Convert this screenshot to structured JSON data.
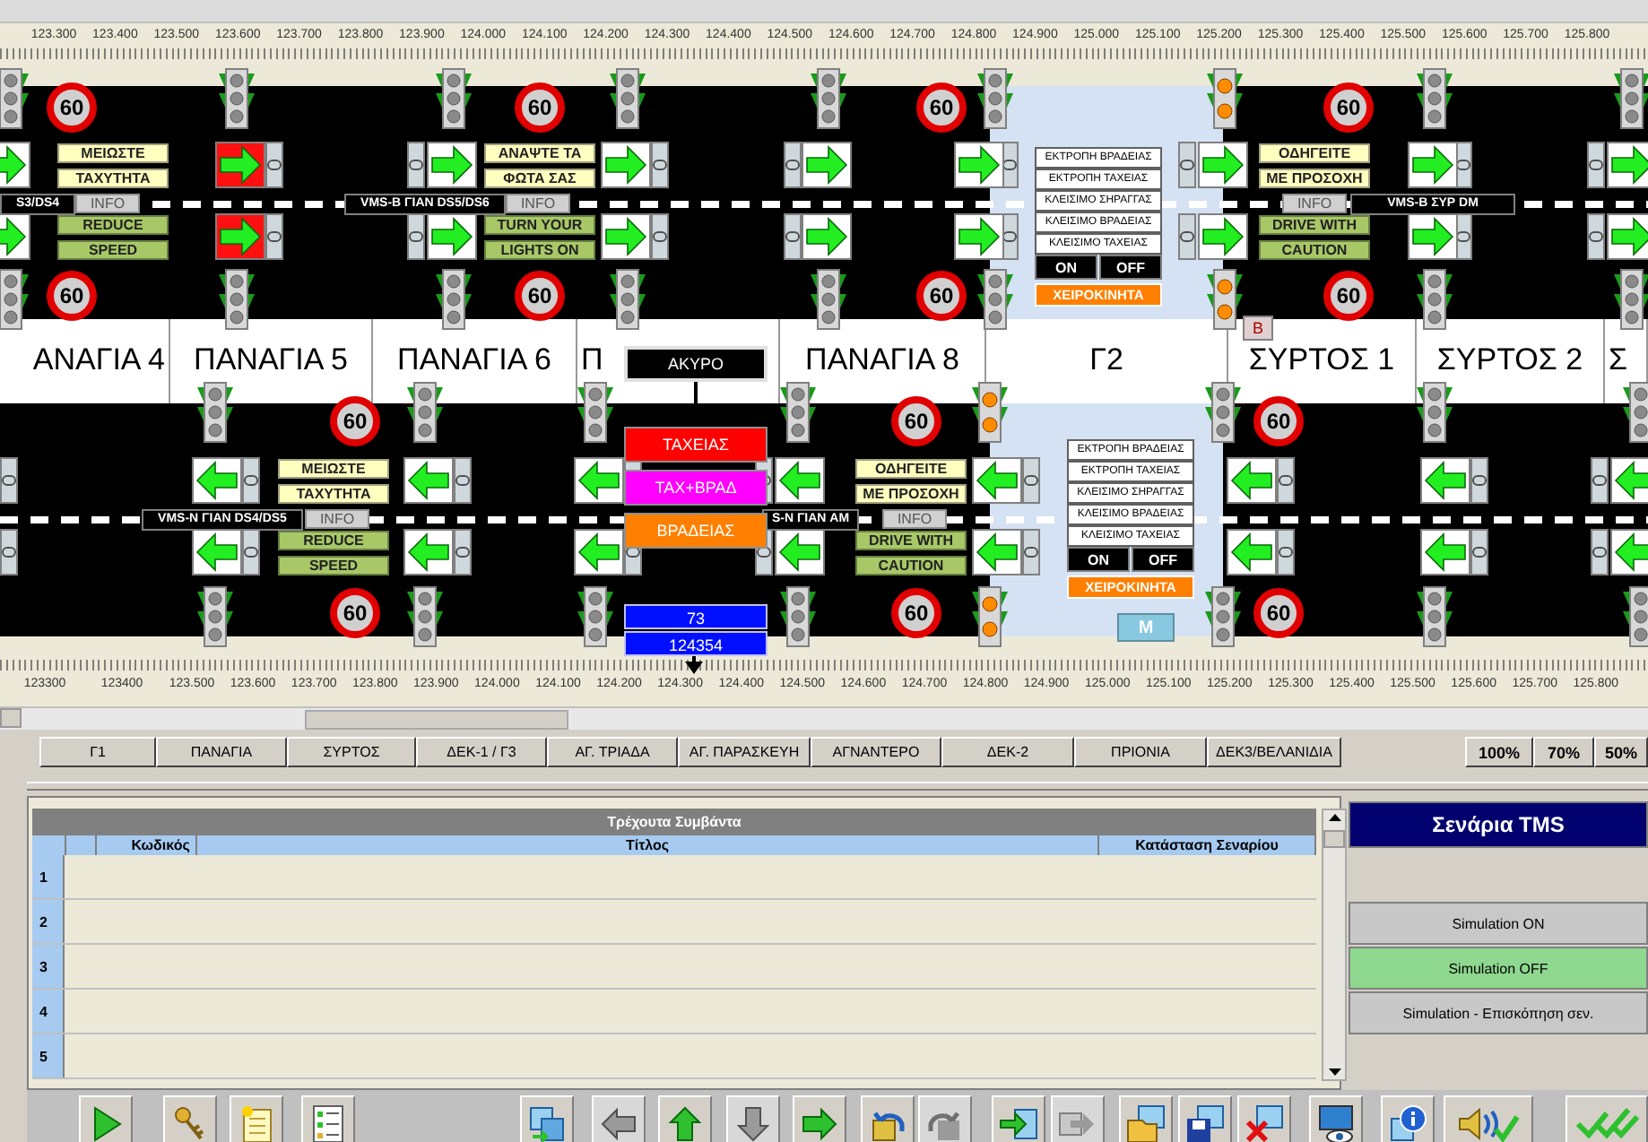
{
  "top_ruler": {
    "labels": [
      "123.300",
      "123.400",
      "123.500",
      "123.600",
      "123.700",
      "123.800",
      "123.900",
      "124.000",
      "124.100",
      "124.200",
      "124.300",
      "124.400",
      "124.500",
      "124.600",
      "124.700",
      "124.800",
      "124.900",
      "125.000",
      "125.100",
      "125.200",
      "125.300",
      "125.400",
      "125.500",
      "125.600",
      "125.700",
      "125.800"
    ]
  },
  "upper_road": {
    "kind": "right",
    "traffic_lights": [
      {
        "kind": "standard"
      },
      {
        "kind": "standard"
      },
      {
        "kind": "standard"
      },
      {
        "kind": "standard"
      },
      {
        "kind": "standard"
      },
      {
        "kind": "standard"
      },
      {
        "kind": "amber"
      },
      {
        "kind": "standard"
      },
      {
        "kind": "standard"
      },
      {
        "kind": "standard"
      },
      {
        "kind": "standard"
      },
      {
        "kind": "standard"
      },
      {
        "kind": "standard"
      },
      {
        "kind": "standard"
      },
      {
        "kind": "standard"
      },
      {
        "kind": "amber"
      },
      {
        "kind": "standard"
      },
      {
        "kind": "standard"
      }
    ],
    "speed_signs": [
      "60",
      "60",
      "60",
      "60",
      "60",
      "60",
      "60",
      "60"
    ],
    "lanes": [
      {
        "signals": [
          {
            "stop": false
          },
          {
            "stop": true
          },
          {
            "stop": false
          },
          {
            "stop": false
          },
          {
            "stop": false
          },
          {
            "stop": false
          },
          {
            "stop": false
          },
          {
            "stop": false
          },
          {
            "stop": false
          }
        ]
      },
      {
        "signals": [
          {
            "stop": false
          },
          {
            "stop": true
          },
          {
            "stop": false
          },
          {
            "stop": false
          },
          {
            "stop": false
          },
          {
            "stop": false
          },
          {
            "stop": false
          },
          {
            "stop": false
          },
          {
            "stop": false
          }
        ]
      }
    ],
    "vms": [
      {
        "label": "S3/DS4",
        "info": "INFO",
        "lines": [
          "ΜΕΙΩΣΤΕ",
          "ΤΑΧΥΤΗΤΑ",
          "REDUCE",
          "SPEED"
        ]
      },
      {
        "label": "VMS-B ΓΙΑΝ DS5/DS6",
        "info": "INFO",
        "lines": [
          "ΑΝΑΨΤΕ ΤΑ",
          "ΦΩΤΑ ΣΑΣ",
          "TURN YOUR",
          "LIGHTS ON"
        ]
      },
      {
        "label": "VMS-B ΣΥΡ DM",
        "info": "INFO",
        "lines": [
          "ΟΔΗΓΕΙΤΕ",
          "ΜΕ ΠΡΟΣΟΧΗ",
          "DRIVE WITH",
          "CAUTION"
        ]
      }
    ],
    "control_panel": {
      "options": [
        "ΕΚΤΡΟΠΗ ΒΡΑΔΕΙΑΣ",
        "ΕΚΤΡΟΠΗ ΤΑΧΕΙΑΣ",
        "ΚΛΕΙΣΙΜΟ ΣΗΡΑΓΓΑΣ",
        "ΚΛΕΙΣΙΜΟ ΒΡΑΔΕΙΑΣ",
        "ΚΛΕΙΣΙΜΟ ΤΑΧΕΙΑΣ"
      ],
      "on": "ON",
      "off": "OFF",
      "manual": "ΧΕΙΡΟΚΙΝΗΤΑ"
    },
    "panel_button": "B"
  },
  "sections": [
    "ΑΝΑΓΙΑ 4",
    "ΠΑΝΑΓΙΑ 5",
    "ΠΑΝΑΓΙΑ 6",
    "Π",
    "ΠΑΝΑΓΙΑ 8",
    "Γ2",
    "ΣΥΡΤΟΣ 1",
    "ΣΥΡΤΟΣ 2",
    "Σ"
  ],
  "lower_road": {
    "kind": "left",
    "traffic_lights": [
      {
        "kind": "standard"
      },
      {
        "kind": "standard"
      },
      {
        "kind": "standard"
      },
      {
        "kind": "standard"
      },
      {
        "kind": "amber"
      },
      {
        "kind": "standard"
      },
      {
        "kind": "standard"
      },
      {
        "kind": "standard"
      },
      {
        "kind": "standard"
      },
      {
        "kind": "standard"
      },
      {
        "kind": "standard"
      },
      {
        "kind": "standard"
      },
      {
        "kind": "amber"
      },
      {
        "kind": "standard"
      },
      {
        "kind": "standard"
      },
      {
        "kind": "standard"
      }
    ],
    "speed_signs": [
      "60",
      "60",
      "60",
      "60",
      "60",
      "60"
    ],
    "lanes": [
      {
        "signals": [
          {
            "stop": false
          },
          {
            "stop": false
          },
          {
            "stop": false
          },
          {
            "stop": false
          },
          {
            "stop": false
          },
          {
            "stop": false
          },
          {
            "stop": false
          },
          {
            "stop": false
          }
        ]
      },
      {
        "signals": [
          {
            "stop": false
          },
          {
            "stop": false
          },
          {
            "stop": false
          },
          {
            "stop": false
          },
          {
            "stop": false
          },
          {
            "stop": false
          },
          {
            "stop": false
          },
          {
            "stop": false
          }
        ]
      }
    ],
    "vms": [
      {
        "label": "VMS-N ΓΙΑΝ DS4/DS5",
        "info": "INFO",
        "lines": [
          "ΜΕΙΩΣΤΕ",
          "ΤΑΧΥΤΗΤΑ",
          "REDUCE",
          "SPEED"
        ]
      },
      {
        "label": "S-N ΓΙΑΝ AM",
        "info": "INFO",
        "lines": [
          "ΟΔΗΓΕΙΤΕ",
          "ΜΕ ΠΡΟΣΟΧΗ",
          "DRIVE WITH",
          "CAUTION"
        ]
      }
    ],
    "control_panel": {
      "options": [
        "ΕΚΤΡΟΠΗ ΒΡΑΔΕΙΑΣ",
        "ΕΚΤΡΟΠΗ ΤΑΧΕΙΑΣ",
        "ΚΛΕΙΣΙΜΟ ΣΗΡΑΓΓΑΣ",
        "ΚΛΕΙΣΙΜΟ ΒΡΑΔΕΙΑΣ",
        "ΚΛΕΙΣΙΜΟ ΤΑΧΕΙΑΣ"
      ],
      "on": "ON",
      "off": "OFF",
      "manual": "ΧΕΙΡΟΚΙΝΗΤΑ"
    },
    "panel_button": "M"
  },
  "popup": {
    "cancel": "ΑΚΥΡΟ",
    "options": [
      {
        "label": "ΤΑΧΕΙΑΣ",
        "color": "#ff0000"
      },
      {
        "label": "ΤΑΧ+ΒΡΑΔ",
        "color": "#ff00ff"
      },
      {
        "label": "ΒΡΑΔΕΙΑΣ",
        "color": "#ff8000"
      }
    ],
    "readout": [
      "73",
      "124354"
    ]
  },
  "bottom_ruler": {
    "labels": [
      "123300",
      "123400",
      "123.500",
      "123.600",
      "123.700",
      "123.800",
      "123.900",
      "124.000",
      "124.100",
      "124.200",
      "124.300",
      "124.400",
      "124.500",
      "124.600",
      "124.700",
      "124.800",
      "124.900",
      "125.000",
      "125.100",
      "125.200",
      "125.300",
      "125.400",
      "125.500",
      "125.600",
      "125.700",
      "125.800"
    ]
  },
  "section_tabs": [
    "Γ1",
    "ΠΑΝΑΓΙΑ",
    "ΣΥΡΤΟΣ",
    "ΔΕΚ-1 / Γ3",
    "ΑΓ. ΤΡΙΑΔΑ",
    "ΑΓ. ΠΑΡΑΣΚΕΥΗ",
    "ΑΓΝΑΝΤΕΡΟ",
    "ΔΕΚ-2",
    "ΠΡΙΟΝΙΑ",
    "ΔΕΚ3/ΒΕΛΑΝΙΔΙΑ"
  ],
  "zoom_buttons": [
    "100%",
    "70%",
    "50%"
  ],
  "events_table": {
    "title": "Τρέχουτα Συμβάντα",
    "columns": [
      "Κωδικός",
      "Τίτλος",
      "Κατάσταση Σεναρίου"
    ],
    "row_numbers": [
      "1",
      "2",
      "3",
      "4",
      "5"
    ]
  },
  "scenarios": {
    "title": "Σενάρια TMS",
    "buttons": [
      {
        "label": "Simulation ON",
        "selected": false
      },
      {
        "label": "Simulation OFF",
        "selected": true
      },
      {
        "label": "Simulation - Επισκόπηση σεν.",
        "selected": false
      }
    ]
  },
  "toolbar": [
    {
      "kind": "play",
      "disabled": false
    },
    {
      "kind": "keys",
      "disabled": false
    },
    {
      "kind": "notepad",
      "disabled": false
    },
    {
      "kind": "checklist",
      "disabled": false
    },
    {
      "kind": "transfer",
      "disabled": false
    },
    {
      "kind": "left",
      "disabled": true
    },
    {
      "kind": "up",
      "disabled": false
    },
    {
      "kind": "down",
      "disabled": true
    },
    {
      "kind": "right",
      "disabled": false
    },
    {
      "kind": "undo",
      "disabled": false
    },
    {
      "kind": "redo",
      "disabled": true
    },
    {
      "kind": "import",
      "disabled": false
    },
    {
      "kind": "export",
      "disabled": true
    },
    {
      "kind": "open",
      "disabled": false
    },
    {
      "kind": "save",
      "disabled": false
    },
    {
      "kind": "delete",
      "disabled": false
    },
    {
      "kind": "monitor",
      "disabled": false
    },
    {
      "kind": "info",
      "disabled": false
    },
    {
      "kind": "audio",
      "disabled": false
    },
    {
      "kind": "check",
      "disabled": false
    }
  ]
}
